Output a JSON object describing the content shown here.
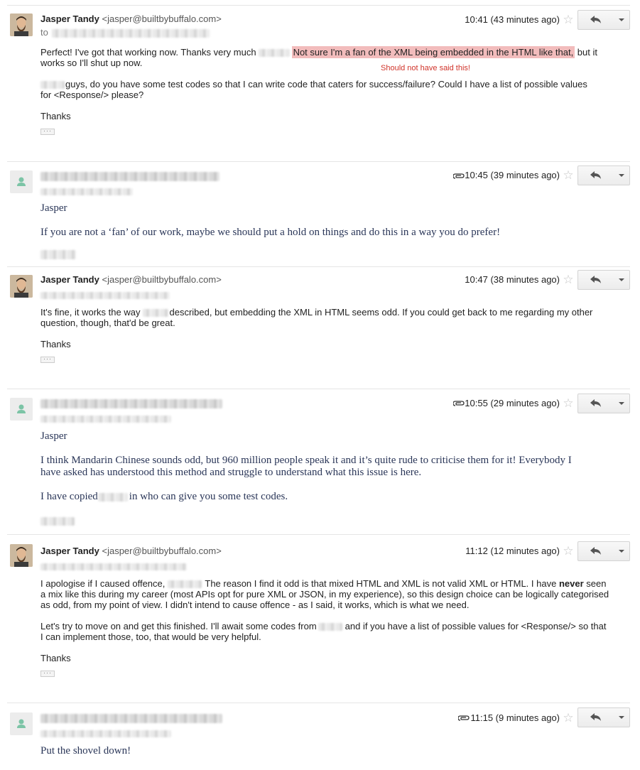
{
  "messages": [
    {
      "sender_name": "Jasper Tandy",
      "sender_email": "<jasper@builtbybuffalo.com>",
      "to_label": "to",
      "time": "10:41 (43 minutes ago)",
      "body": {
        "p1_before": "Perfect! I've got that working now. Thanks very much",
        "p1_highlight": "Not sure I'm a fan of the XML being embedded in the HTML like that,",
        "p1_after": " but it",
        "p1_line2": "works so I'll shut up now.",
        "p2_after_name": "guys, do you have some test codes so that I can write code that caters for success/failure? Could I have a list of possible values",
        "p2_line2": "for <Response/> please?",
        "p3": "Thanks"
      },
      "annotation": "Should not have said this!"
    },
    {
      "time": "10:45 (39 minutes ago)",
      "body": {
        "p1": "Jasper",
        "p2": "If you are not a ‘fan’ of our work, maybe we should put a hold on things and do this in a way you do prefer!"
      }
    },
    {
      "sender_name": "Jasper Tandy",
      "sender_email": "<jasper@builtbybuffalo.com>",
      "time": "10:47 (38 minutes ago)",
      "body": {
        "p1_before": "It's fine, it works the way",
        "p1_after": "described, but embedding the XML in HTML seems odd. If you could get back to me regarding my other",
        "p1_line2": "question, though, that'd be great.",
        "p2": "Thanks"
      }
    },
    {
      "time": "10:55 (29 minutes ago)",
      "body": {
        "p1": "Jasper",
        "p2_line1": "I think Mandarin Chinese sounds odd, but 960 million people speak it and it’s quite rude to criticise them for it!  Everybody I",
        "p2_line2": "have asked has understood this method and struggle to understand what this issue is here.",
        "p3_before": "I have copied",
        "p3_after": "in who can give you some test codes."
      }
    },
    {
      "sender_name": "Jasper Tandy",
      "sender_email": "<jasper@builtbybuffalo.com>",
      "time": "11:12 (12 minutes ago)",
      "body": {
        "p1_before": "I apologise if I caused offence,",
        "p1_after": "The reason I find it odd is that mixed HTML and XML is not valid XML or HTML. I have ",
        "p1_bold": "never",
        "p1_after2": " seen",
        "p1_line2": "a mix like this during my career (most APIs opt for pure XML or JSON, in my experience), so this design choice can be logically categorised",
        "p1_line3": "as odd, from my point of view. I didn't intend to cause offence - as I said, it works, which is what we need.",
        "p2_before": "Let's try to move on and get this finished. I'll await some codes from",
        "p2_after": "and if you have a list of possible values for <Response/> so that",
        "p2_line2": "I can implement those, too, that would be very helpful.",
        "p3": "Thanks"
      }
    },
    {
      "time": "11:15 (9 minutes ago)",
      "body": {
        "p1": "Put the shovel down!"
      }
    }
  ],
  "colors": {
    "highlight": "#f2bcbc",
    "annotation": "#d0332a",
    "serif_text": "#2a3658"
  },
  "icons": [
    "star-icon",
    "reply-icon",
    "chevron-down-icon",
    "paperclip-icon",
    "person-icon"
  ]
}
